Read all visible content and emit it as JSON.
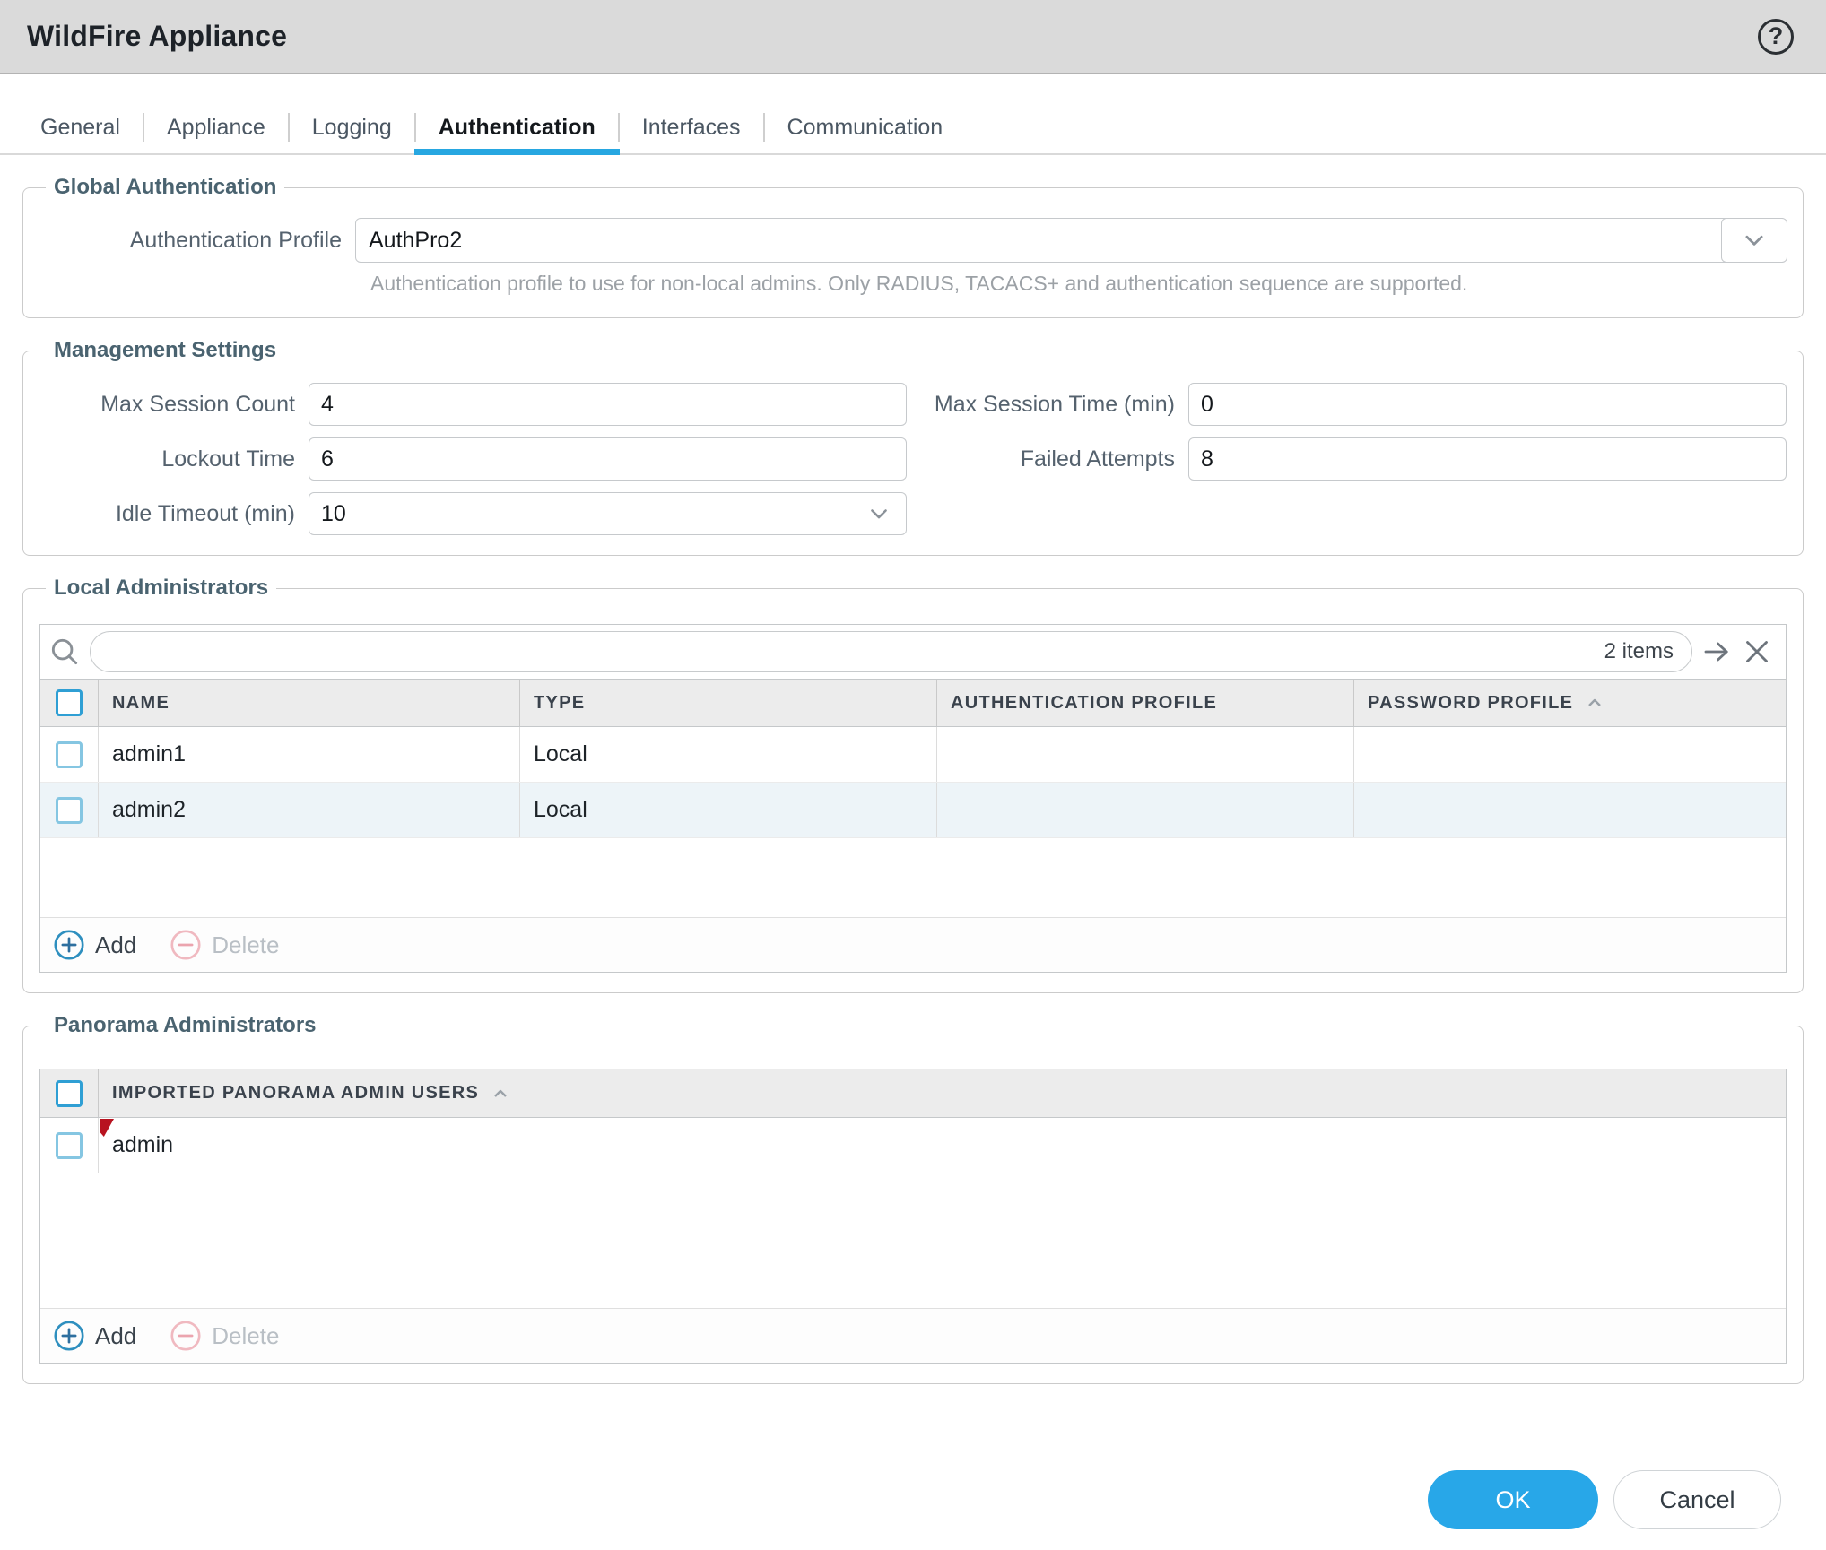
{
  "window": {
    "title": "WildFire Appliance"
  },
  "tabs": [
    {
      "label": "General",
      "active": false
    },
    {
      "label": "Appliance",
      "active": false
    },
    {
      "label": "Logging",
      "active": false
    },
    {
      "label": "Authentication",
      "active": true
    },
    {
      "label": "Interfaces",
      "active": false
    },
    {
      "label": "Communication",
      "active": false
    }
  ],
  "global_auth": {
    "legend": "Global Authentication",
    "auth_profile_label": "Authentication Profile",
    "auth_profile_value": "AuthPro2",
    "helper": "Authentication profile to use for non-local admins. Only RADIUS, TACACS+ and authentication sequence are supported."
  },
  "management": {
    "legend": "Management Settings",
    "max_session_count": {
      "label": "Max Session Count",
      "value": "4"
    },
    "max_session_time": {
      "label": "Max Session Time (min)",
      "value": "0"
    },
    "lockout_time": {
      "label": "Lockout Time",
      "value": "6"
    },
    "failed_attempts": {
      "label": "Failed Attempts",
      "value": "8"
    },
    "idle_timeout": {
      "label": "Idle Timeout (min)",
      "value": "10"
    }
  },
  "local_admins": {
    "legend": "Local Administrators",
    "items_count": "2 items",
    "columns": {
      "name": "NAME",
      "type": "TYPE",
      "auth_profile": "AUTHENTICATION PROFILE",
      "password_profile": "PASSWORD PROFILE"
    },
    "sorted_column": "PASSWORD PROFILE",
    "rows": [
      {
        "name": "admin1",
        "type": "Local",
        "auth_profile": "",
        "password_profile": ""
      },
      {
        "name": "admin2",
        "type": "Local",
        "auth_profile": "",
        "password_profile": ""
      }
    ],
    "add_label": "Add",
    "delete_label": "Delete"
  },
  "panorama_admins": {
    "legend": "Panorama Administrators",
    "column": "IMPORTED PANORAMA ADMIN USERS",
    "rows": [
      {
        "name": "admin",
        "modified": true
      }
    ],
    "add_label": "Add",
    "delete_label": "Delete"
  },
  "footer": {
    "ok_label": "OK",
    "cancel_label": "Cancel"
  },
  "colors": {
    "accent": "#27a7e1",
    "ok_button": "#28a7e8",
    "modified_marker": "#b81320",
    "legend_text": "#4a6370",
    "row_stripe": "#edf4f8"
  }
}
